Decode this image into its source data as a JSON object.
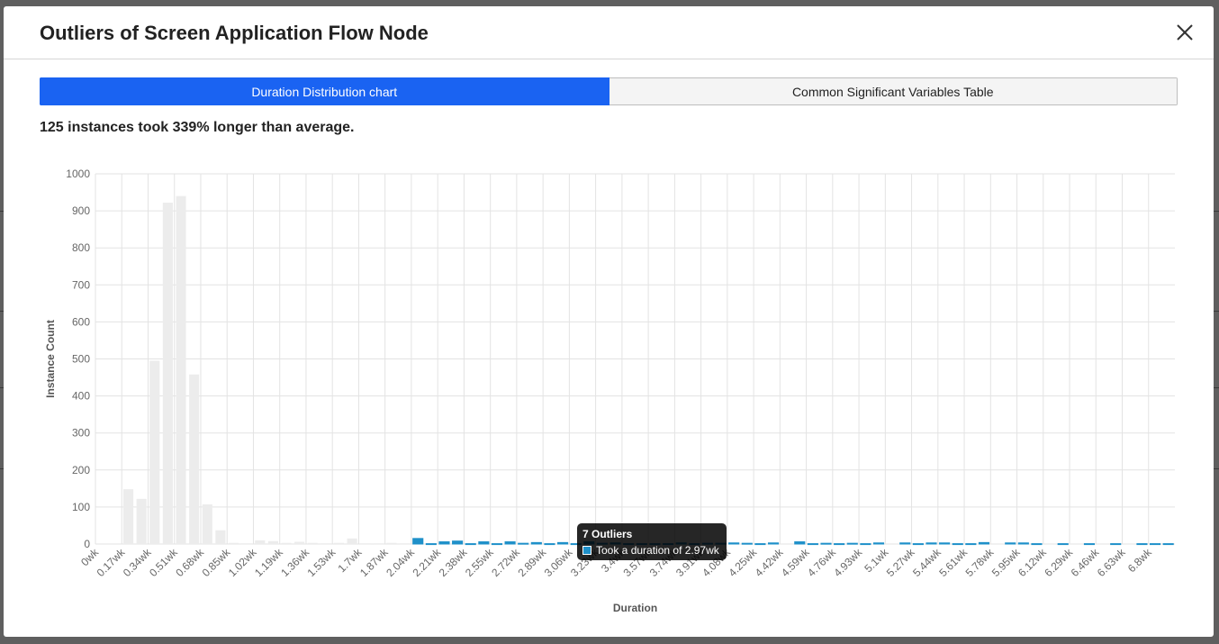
{
  "modal": {
    "title": "Outliers of Screen Application Flow Node",
    "close_icon": "close-icon"
  },
  "tabs": [
    {
      "label": "Duration Distribution chart",
      "active": true
    },
    {
      "label": "Common Significant Variables Table",
      "active": false
    }
  ],
  "summary": "125 instances took 339% longer than average.",
  "tooltip": {
    "title": "7 Outliers",
    "text": "Took a duration of 2.97wk"
  },
  "colors": {
    "accent": "#1a63f2",
    "normal_bar": "#ececec",
    "outlier_bar": "#1f90c9"
  },
  "chart_data": {
    "type": "bar",
    "xlabel": "Duration",
    "ylabel": "Instance Count",
    "ylim": [
      0,
      1000
    ],
    "yticks": [
      0,
      100,
      200,
      300,
      400,
      500,
      600,
      700,
      800,
      900,
      1000
    ],
    "tick_labels": [
      "0wk",
      "0.17wk",
      "0.34wk",
      "0.51wk",
      "0.68wk",
      "0.85wk",
      "1.02wk",
      "1.19wk",
      "1.36wk",
      "1.53wk",
      "1.7wk",
      "1.87wk",
      "2.04wk",
      "2.21wk",
      "2.38wk",
      "2.55wk",
      "2.72wk",
      "2.89wk",
      "3.06wk",
      "3.23wk",
      "3.4wk",
      "3.57wk",
      "3.74wk",
      "3.91wk",
      "4.08wk",
      "4.25wk",
      "4.42wk",
      "4.59wk",
      "4.76wk",
      "4.93wk",
      "5.1wk",
      "5.27wk",
      "5.44wk",
      "5.61wk",
      "5.78wk",
      "5.95wk",
      "6.12wk",
      "6.29wk",
      "6.46wk",
      "6.63wk",
      "6.8wk"
    ],
    "bin_width_wk": 0.085,
    "values": [
      0,
      0,
      148,
      122,
      495,
      922,
      940,
      458,
      107,
      37,
      3,
      2,
      10,
      8,
      3,
      6,
      3,
      2,
      3,
      15,
      2,
      2,
      3,
      2,
      15,
      1,
      6,
      8,
      1,
      6,
      1,
      6,
      2,
      4,
      1,
      4,
      1,
      6,
      2,
      3,
      1,
      1,
      1,
      1,
      3,
      1,
      2,
      2,
      3,
      2,
      1,
      3,
      0,
      6,
      1,
      2,
      1,
      2,
      1,
      3,
      0,
      3,
      1,
      3,
      3,
      1,
      1,
      4,
      0,
      3,
      3,
      1,
      0,
      1,
      0,
      1,
      0,
      1,
      0,
      1,
      1,
      1
    ],
    "categories_binned": "bin i covers duration i*0.085wk",
    "outlier_threshold_index": 24,
    "grid": true,
    "legend": "none"
  }
}
